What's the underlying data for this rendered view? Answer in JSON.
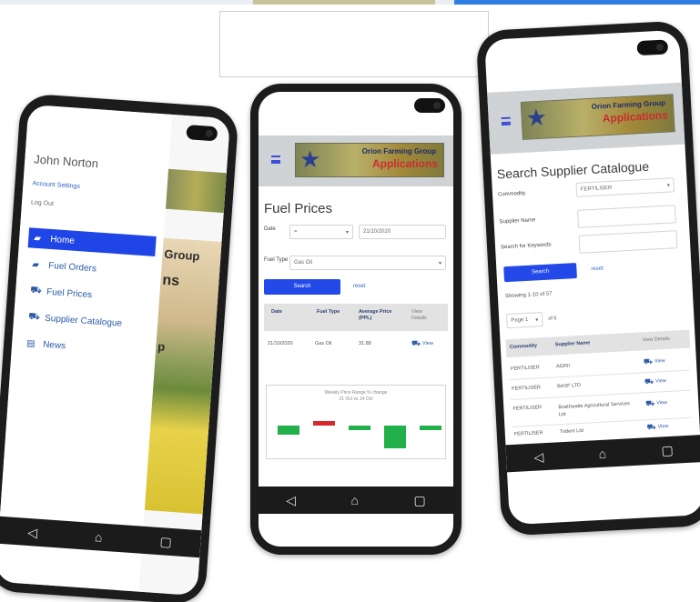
{
  "colors": {
    "accent_blue": "#2349e8",
    "link_blue": "#2a64c9",
    "nav_dark": "#1b1b1b",
    "header_grey": "#cfd3d6",
    "bar_green": "#22b04a",
    "bar_red": "#d62a2a"
  },
  "logo": {
    "line1": "Orion Farming Group",
    "line2": "Applications"
  },
  "nav_icons": {
    "back": "◁",
    "home": "⌂",
    "recent": "▢"
  },
  "left_phone": {
    "user_name": "John Norton",
    "account_settings": "Account Settings",
    "log_out": "Log Out",
    "menu": [
      {
        "label": "Home",
        "icon": "home-icon",
        "glyph": "▰"
      },
      {
        "label": "Fuel Orders",
        "icon": "truck-icon",
        "glyph": "▰"
      },
      {
        "label": "Fuel Prices",
        "icon": "binoculars-icon",
        "glyph": "⛟"
      },
      {
        "label": "Supplier Catalogue",
        "icon": "binoculars-icon",
        "glyph": "⛟"
      },
      {
        "label": "News",
        "icon": "newspaper-icon",
        "glyph": "▤"
      }
    ],
    "hero_text": [
      "Group",
      "ns",
      "p"
    ]
  },
  "mid_phone": {
    "title": "Fuel Prices",
    "date_label": "Date",
    "date_operator": "=",
    "date_value": "21/10/2020",
    "fuel_type_label": "Fuel Type",
    "fuel_type_value": "Gas Oil",
    "search_button": "Search",
    "reset_link": "reset",
    "table_headers": [
      "Date",
      "Fuel Type",
      "Average Price (PPL)",
      "View Details"
    ],
    "table_rows": [
      {
        "date": "21/10/2020",
        "fuel_type": "Gas Oil",
        "price": "31.88",
        "view": "View"
      }
    ],
    "chart_title": "Weekly Price Range % change",
    "chart_subtitle": "21 Oct vs 14 Oct"
  },
  "chart_data": {
    "type": "bar",
    "title": "Weekly Price Range % change",
    "subtitle": "21 Oct vs 14 Oct",
    "values": [
      2,
      -1,
      1,
      5,
      1
    ]
  },
  "right_phone": {
    "title": "Search Supplier Catalogue",
    "commodity_label": "Commodity",
    "commodity_value": "FERTILISER",
    "supplier_name_label": "Supplier Name",
    "keywords_label": "Search for Keywords",
    "search_button": "Search",
    "reset_link": "reset",
    "showing_text": "Showing 1-10 of 57",
    "page_label": "Page 1",
    "page_of": "of 6",
    "table_headers": [
      "Commodity",
      "Supplier Name",
      "View Details"
    ],
    "rows": [
      {
        "commodity": "FERTILISER",
        "supplier": "AGRII",
        "view": "View"
      },
      {
        "commodity": "FERTILISER",
        "supplier": "BASF LTD",
        "view": "View"
      },
      {
        "commodity": "FERTILISER",
        "supplier": "Braithwaite Agricultural Services Ltd",
        "view": "View"
      },
      {
        "commodity": "FERTILISER",
        "supplier": "Trident Ltd",
        "view": "View"
      }
    ]
  }
}
